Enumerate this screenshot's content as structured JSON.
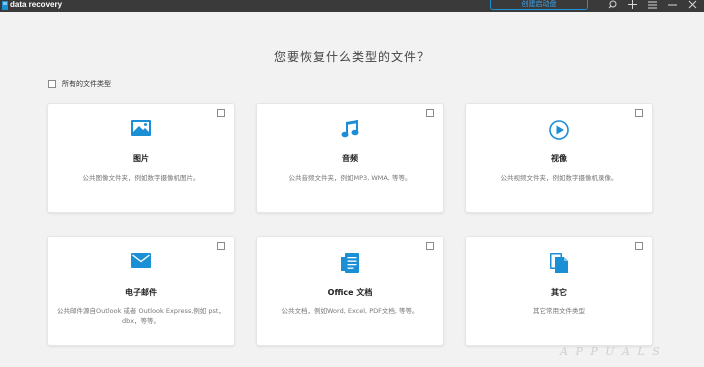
{
  "titlebar": {
    "app_title": "data recovery",
    "create_button": "创建启动盘"
  },
  "heading": "您要恢复什么类型的文件？",
  "all_types_label": "所有的文件类型",
  "cards": [
    {
      "icon": "image-icon",
      "title": "图片",
      "desc": "公共图像文件夹，例如数字摄像机图片。"
    },
    {
      "icon": "music-note-icon",
      "title": "音频",
      "desc": "公共音频文件夹，例如MP3, WMA, 等等。"
    },
    {
      "icon": "play-icon",
      "title": "视像",
      "desc": "公共视频文件夹，例如数字摄像机录像。"
    },
    {
      "icon": "mail-icon",
      "title": "电子邮件",
      "desc": "公共邮件源自Outlook 或者 Outlook Express,例如 pst，dbx，等等。"
    },
    {
      "icon": "document-icon",
      "title": "Office 文档",
      "desc": "公共文档，例如Word, Excel, PDF文档, 等等。"
    },
    {
      "icon": "files-icon",
      "title": "其它",
      "desc": "其它常用文件类型"
    }
  ],
  "watermark": "A P P U A L S",
  "colors": {
    "accent": "#1a8fd6",
    "titlebar": "#3a3a3a",
    "background": "#f2f2f2"
  }
}
